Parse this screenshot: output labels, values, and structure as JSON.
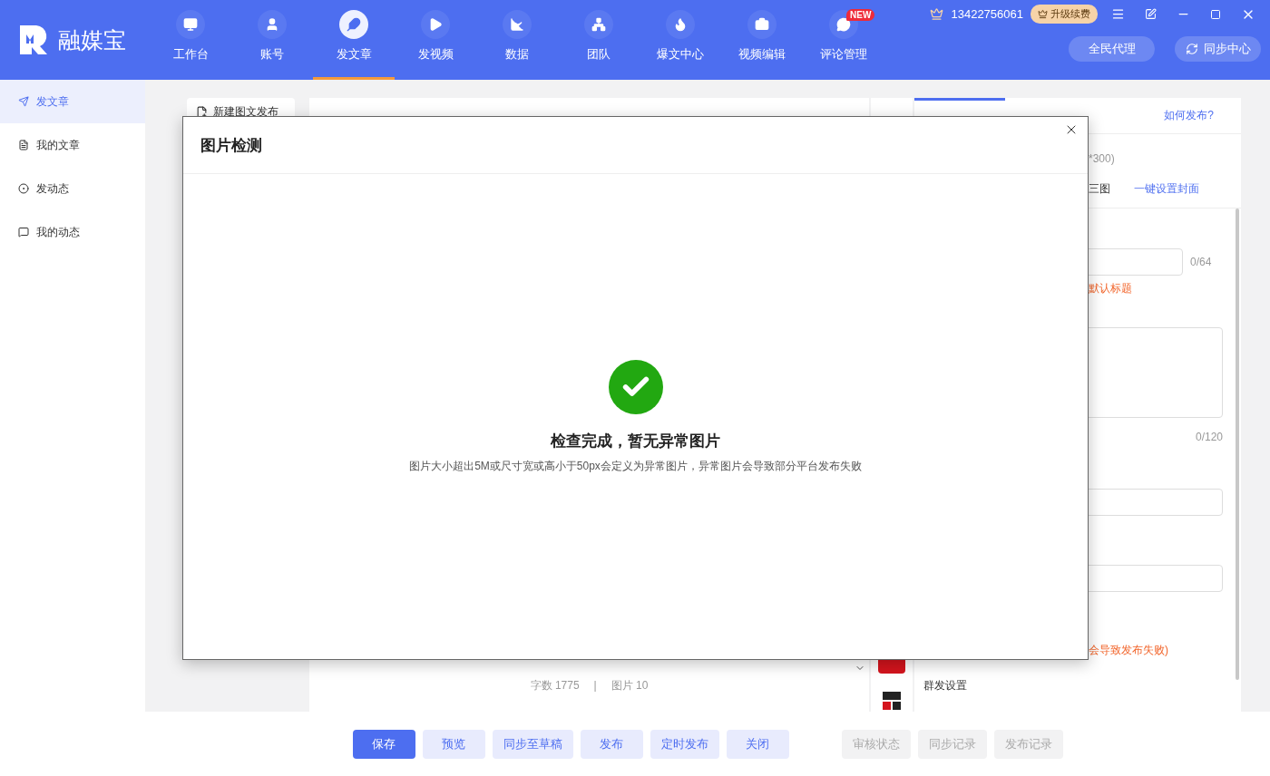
{
  "app": {
    "name": "融媒宝"
  },
  "nav": [
    {
      "label": "工作台",
      "selected": false
    },
    {
      "label": "账号",
      "selected": false
    },
    {
      "label": "发文章",
      "selected": true
    },
    {
      "label": "发视频",
      "selected": false
    },
    {
      "label": "数据",
      "selected": false
    },
    {
      "label": "团队",
      "selected": false
    },
    {
      "label": "爆文中心",
      "selected": false
    },
    {
      "label": "视频编辑",
      "selected": false
    },
    {
      "label": "评论管理",
      "selected": false,
      "badge": "NEW"
    }
  ],
  "account": {
    "phone": "13422756061",
    "upgrade": "升级续费"
  },
  "header_buttons": [
    "全民代理",
    "同步中心"
  ],
  "sidebar": [
    {
      "label": "发文章",
      "selected": true
    },
    {
      "label": "我的文章",
      "selected": false
    },
    {
      "label": "发动态",
      "selected": false
    },
    {
      "label": "我的动态",
      "selected": false
    }
  ],
  "new_post": "新建图文发布",
  "editor": {
    "word_count": "字数 1775",
    "separator": "|",
    "image_count": "图片 10"
  },
  "settings_panel": {
    "help_link": "如何发布?",
    "size_hint": "*300)",
    "cover_option": "三图",
    "cover_link": "一键设置封面",
    "title_count": "0/64",
    "title_hint": "默认标题",
    "summary_count": "0/120",
    "original_note": "会导致发布失败)",
    "group_label": "群发设置"
  },
  "dialog": {
    "title": "图片检测",
    "result": "检查完成，暂无异常图片",
    "note": "图片大小超出5M或尺寸宽或高小于50px会定义为异常图片，异常图片会导致部分平台发布失败"
  },
  "actions": [
    {
      "label": "保存",
      "kind": "primary"
    },
    {
      "label": "预览",
      "kind": "secondary"
    },
    {
      "label": "同步至草稿",
      "kind": "secondary"
    },
    {
      "label": "发布",
      "kind": "secondary"
    },
    {
      "label": "定时发布",
      "kind": "secondary"
    },
    {
      "label": "关闭",
      "kind": "secondary"
    },
    {
      "label": "审核状态",
      "kind": "disabled"
    },
    {
      "label": "同步记录",
      "kind": "disabled"
    },
    {
      "label": "发布记录",
      "kind": "disabled"
    }
  ]
}
